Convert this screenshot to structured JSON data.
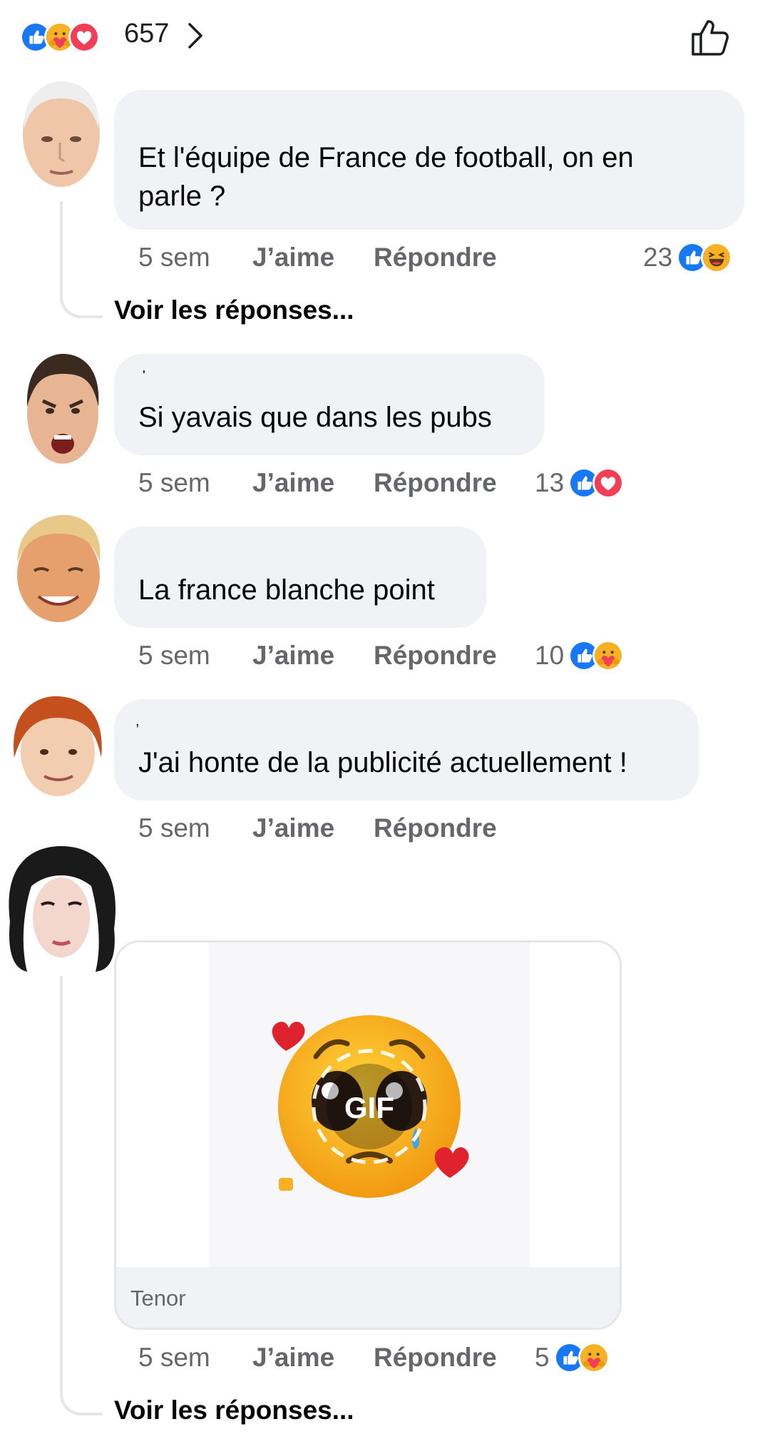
{
  "header": {
    "reaction_icons": [
      "like-icon",
      "care-icon",
      "love-icon"
    ],
    "reaction_count": "657"
  },
  "comments": [
    {
      "author_avatar": "avatar-1",
      "text": "Et l'équipe de France de football, on en parle ?",
      "text_lines": [
        "Et l'équipe de France de football, on en",
        "parle ?"
      ],
      "time": "5 sem",
      "like_label": "J’aime",
      "reply_label": "Répondre",
      "reaction_count": "23",
      "reaction_icons": [
        "like-icon",
        "haha-icon"
      ],
      "see_replies": "Voir les réponses..."
    },
    {
      "author_avatar": "avatar-2",
      "text": "Si yavais que dans les pubs",
      "time": "5 sem",
      "like_label": "J’aime",
      "reply_label": "Répondre",
      "reaction_count": "13",
      "reaction_icons": [
        "like-icon",
        "love-icon"
      ]
    },
    {
      "author_avatar": "avatar-3",
      "text": "La france blanche point",
      "time": "5 sem",
      "like_label": "J’aime",
      "reply_label": "Répondre",
      "reaction_count": "10",
      "reaction_icons": [
        "like-icon",
        "care-icon"
      ]
    },
    {
      "author_avatar": "avatar-4",
      "text": "J'ai honte de la publicité actuellement !",
      "time": "5 sem",
      "like_label": "J’aime",
      "reply_label": "Répondre"
    },
    {
      "author_avatar": "avatar-5",
      "gif_label": "GIF",
      "gif_source": "Tenor",
      "time": "5 sem",
      "like_label": "J’aime",
      "reply_label": "Répondre",
      "reaction_count": "5",
      "reaction_icons": [
        "like-icon",
        "care-icon"
      ],
      "see_replies": "Voir les réponses..."
    }
  ],
  "colors": {
    "like": "#1877f2",
    "love": "#f33e58",
    "care": "#f7b125",
    "bubble": "#f0f2f5",
    "meta_text": "#65676b"
  }
}
